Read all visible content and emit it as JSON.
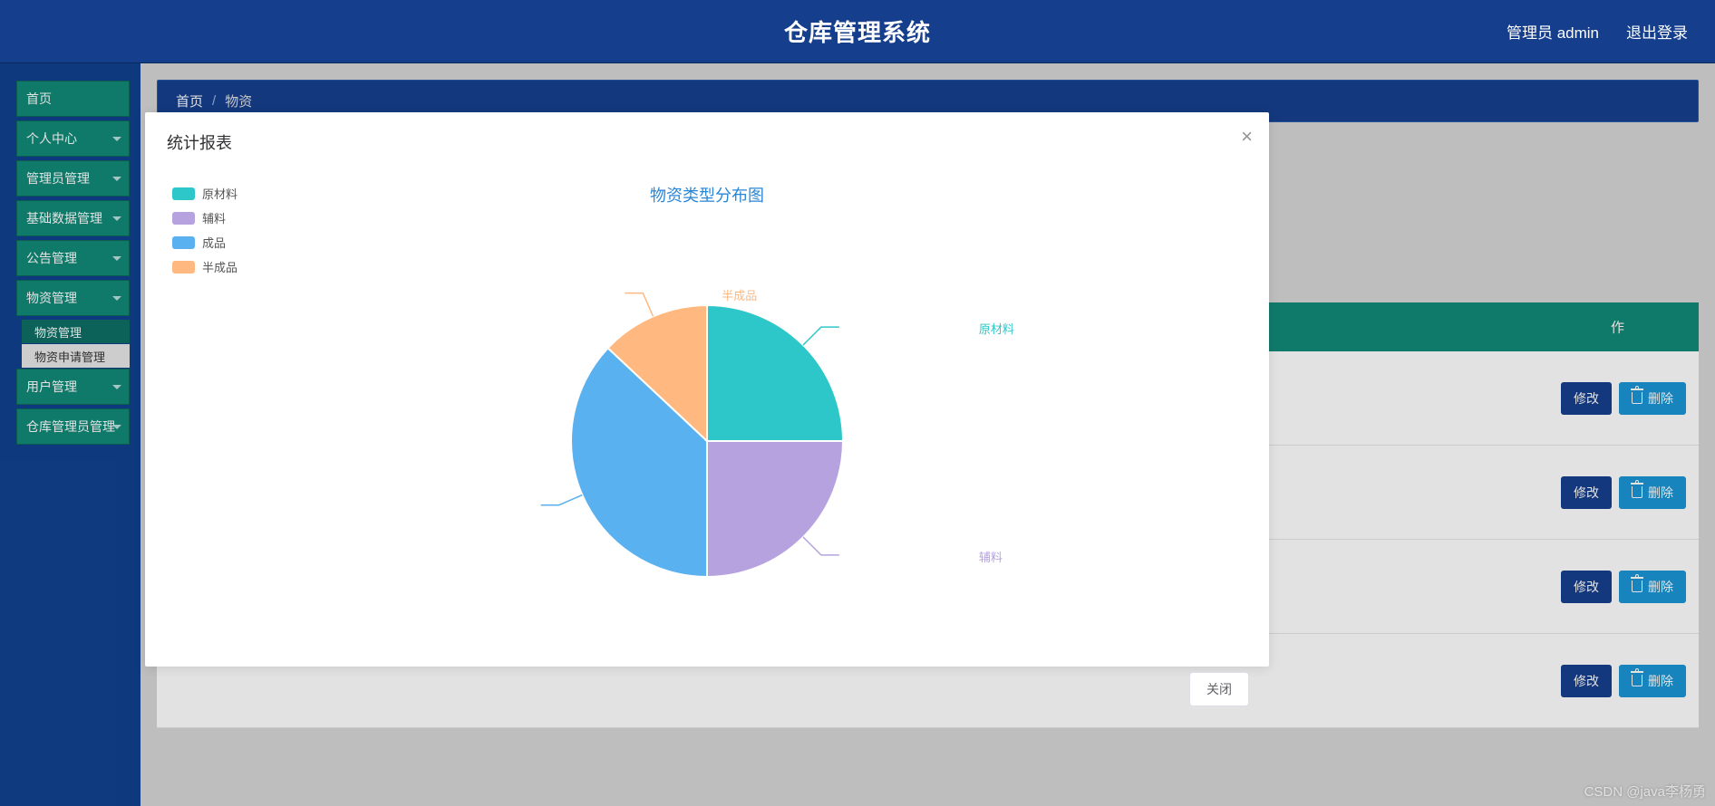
{
  "header": {
    "title": "仓库管理系统",
    "user_label": "管理员 admin",
    "logout_label": "退出登录"
  },
  "sidebar": {
    "items": [
      {
        "label": "首页",
        "arrow": false
      },
      {
        "label": "个人中心",
        "arrow": true
      },
      {
        "label": "管理员管理",
        "arrow": true
      },
      {
        "label": "基础数据管理",
        "arrow": true
      },
      {
        "label": "公告管理",
        "arrow": true
      },
      {
        "label": "物资管理",
        "arrow": true
      },
      {
        "label": "用户管理",
        "arrow": true
      },
      {
        "label": "仓库管理员管理",
        "arrow": true
      }
    ],
    "subitems": [
      {
        "label": "物资管理",
        "state": "sel"
      },
      {
        "label": "物资申请管理",
        "state": "active"
      }
    ]
  },
  "breadcrumb": {
    "home": "首页",
    "sep": "/",
    "current": "物资"
  },
  "bg_table": {
    "header_op": "作",
    "rows": [
      {
        "edit": "修改",
        "del": "删除"
      },
      {
        "edit": "修改",
        "del": "删除"
      },
      {
        "edit": "修改",
        "del": "删除"
      },
      {
        "edit": "修改",
        "del": "删除"
      }
    ]
  },
  "modal": {
    "title": "统计报表",
    "close_glyph": "×",
    "footer_btn": "关闭"
  },
  "chart_data": {
    "type": "pie",
    "title": "物资类型分布图",
    "series": [
      {
        "name": "原材料",
        "value": 25,
        "color": "#2ec7c9"
      },
      {
        "name": "辅料",
        "value": 25,
        "color": "#b6a2de"
      },
      {
        "name": "成品",
        "value": 37,
        "color": "#5ab1ef"
      },
      {
        "name": "半成品",
        "value": 13,
        "color": "#ffb980"
      }
    ],
    "legend_position": "top-left"
  },
  "watermark": "CSDN @java李杨勇"
}
